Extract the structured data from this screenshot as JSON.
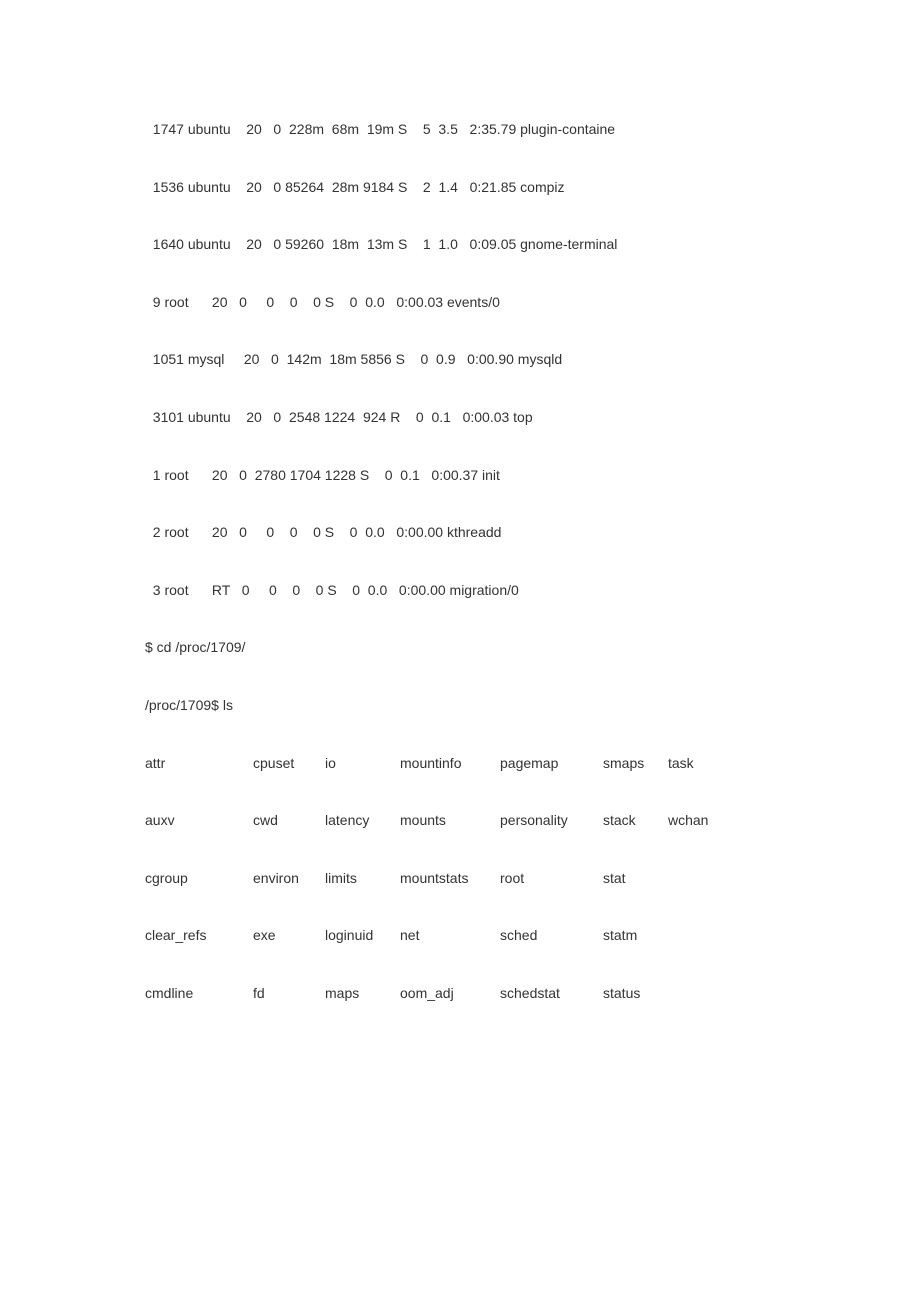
{
  "top_rows": [
    "  1747 ubuntu    20   0  228m  68m  19m S    5  3.5   2:35.79 plugin-containe",
    "  1536 ubuntu    20   0 85264  28m 9184 S    2  1.4   0:21.85 compiz",
    "  1640 ubuntu    20   0 59260  18m  13m S    1  1.0   0:09.05 gnome-terminal",
    "  9 root      20   0     0    0    0 S    0  0.0   0:00.03 events/0",
    "  1051 mysql     20   0  142m  18m 5856 S    0  0.9   0:00.90 mysqld",
    "  3101 ubuntu    20   0  2548 1224  924 R    0  0.1   0:00.03 top",
    "  1 root      20   0  2780 1704 1228 S    0  0.1   0:00.37 init",
    "  2 root      20   0     0    0    0 S    0  0.0   0:00.00 kthreadd",
    "  3 root      RT   0     0    0    0 S    0  0.0   0:00.00 migration/0"
  ],
  "cmd1": "$ cd /proc/1709/",
  "cmd2": "/proc/1709$ ls",
  "ls_rows": [
    [
      "attr",
      "cpuset",
      "io",
      "mountinfo",
      "pagemap",
      "smaps",
      "task"
    ],
    [
      "auxv",
      "cwd",
      "latency",
      "mounts",
      "personality",
      "stack",
      "wchan"
    ],
    [
      "cgroup",
      "environ",
      "limits",
      "mountstats",
      "root",
      "stat",
      ""
    ],
    [
      "clear_refs",
      "exe",
      "loginuid",
      "net",
      "sched",
      "statm",
      ""
    ],
    [
      "cmdline",
      "fd",
      "maps",
      "oom_adj",
      "schedstat",
      "status",
      ""
    ]
  ]
}
